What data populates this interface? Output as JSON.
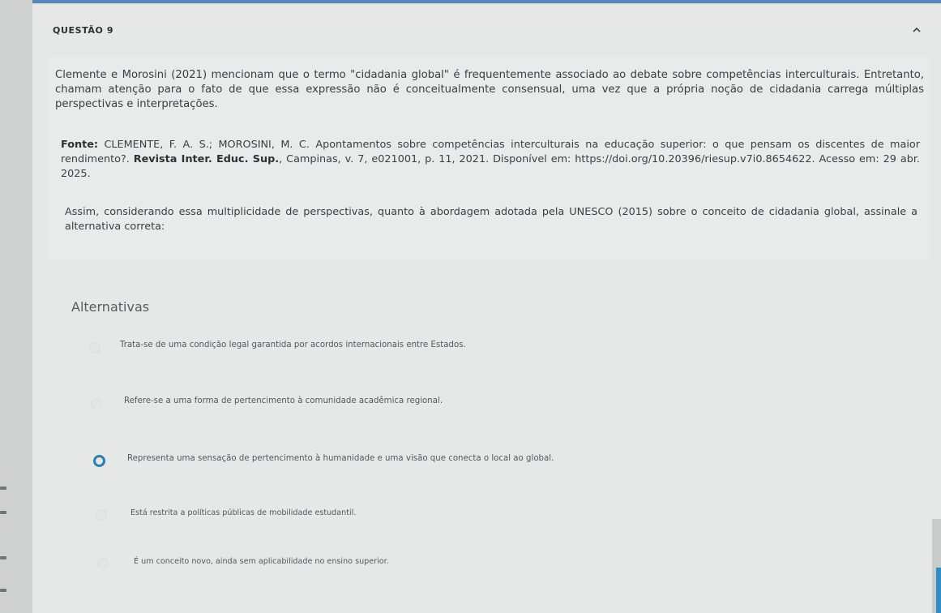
{
  "question": {
    "title": "QUESTÃO 9",
    "collapse_icon": "chevron-up-icon",
    "paragraph1": "Clemente e Morosini (2021) mencionam que o termo \"cidadania global\" é frequentemente associado ao debate sobre competências interculturais. Entretanto, chamam atenção para o fato de que essa expressão não é conceitualmente consensual, uma vez que a própria noção de cidadania carrega múltiplas perspectivas e interpretações.",
    "source_label": "Fonte:",
    "source_text_a": " CLEMENTE, F. A. S.; MOROSINI, M. C. Apontamentos sobre competências interculturais na educação superior: o que pensam os discentes de maior rendimento?. ",
    "source_journal": "Revista Inter. Educ. Sup.",
    "source_text_b": ", Campinas, v. 7, e021001, p. 11, 2021. Disponível em: https://doi.org/10.20396/riesup.v7i0.8654622. Acesso em: 29 abr. 2025.",
    "prompt": "Assim, considerando essa multiplicidade de perspectivas, quanto à abordagem adotada pela UNESCO (2015) sobre o conceito de cidadania global, assinale a alternativa correta:"
  },
  "alternatives": {
    "heading": "Alternativas",
    "options": [
      {
        "label": "Trata-se de uma condição legal garantida por acordos internacionais entre Estados.",
        "selected": false
      },
      {
        "label": "Refere-se a uma forma de pertencimento à comunidade acadêmica regional.",
        "selected": false
      },
      {
        "label": "Representa uma sensação de pertencimento à humanidade e uma visão que conecta o local ao global.",
        "selected": true
      },
      {
        "label": "Está restrita a políticas públicas de mobilidade estudantil.",
        "selected": false
      },
      {
        "label": "É um conceito novo, ainda sem aplicabilidade no ensino superior.",
        "selected": false
      }
    ]
  },
  "colors": {
    "accent": "#2d7fb0",
    "top_bar": "#5a86b8"
  }
}
